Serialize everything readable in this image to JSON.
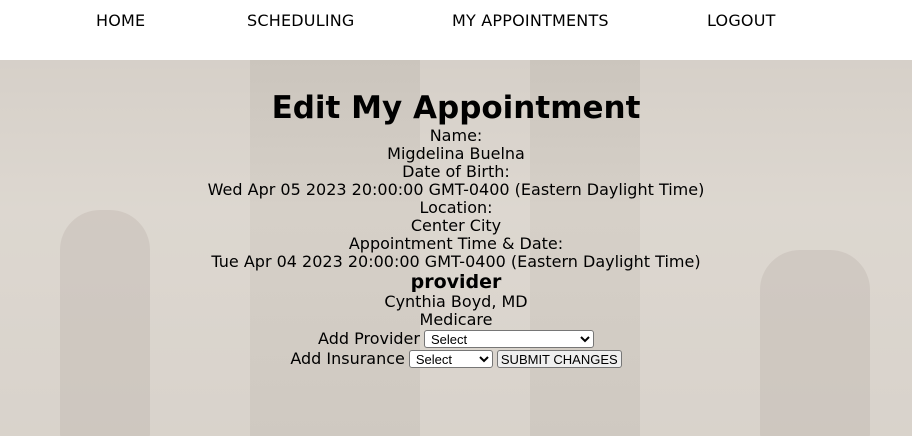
{
  "nav": {
    "items": [
      {
        "label": "HOME"
      },
      {
        "label": "SCHEDULING"
      },
      {
        "label": "MY APPOINTMENTS"
      },
      {
        "label": "LOGOUT"
      }
    ]
  },
  "main": {
    "title": "Edit My Appointment",
    "name_label": "Name:",
    "name_value": "Migdelina Buelna",
    "dob_label": "Date of Birth:",
    "dob_value": "Wed Apr 05 2023 20:00:00 GMT-0400 (Eastern Daylight Time)",
    "location_label": "Location:",
    "location_value": "Center City",
    "time_label": "Appointment Time & Date:",
    "time_value": "Tue Apr 04 2023 20:00:00 GMT-0400 (Eastern Daylight Time)",
    "provider_heading": "provider",
    "provider_value": "Cynthia Boyd, MD",
    "insurance_value": "Medicare"
  },
  "form": {
    "add_provider_label": "Add Provider",
    "provider_select_value": "Select",
    "add_insurance_label": "Add Insurance",
    "insurance_select_value": "Select",
    "submit_label": "SUBMIT CHANGES"
  }
}
